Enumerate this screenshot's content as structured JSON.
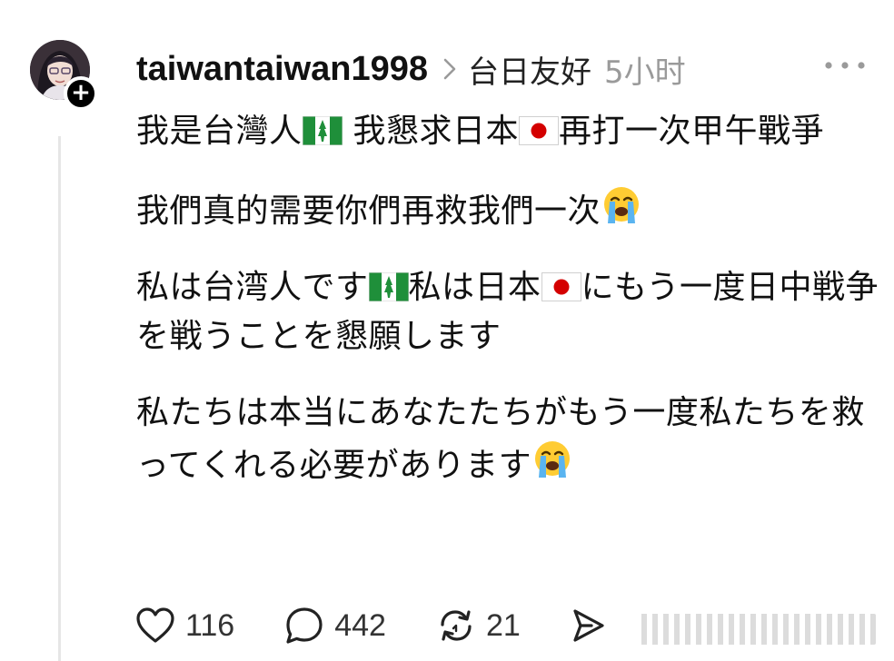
{
  "post": {
    "username": "taiwantaiwan1998",
    "community": "台日友好",
    "time": "5小时",
    "paragraphs": [
      {
        "segments": [
          {
            "text": "我是台灣人"
          },
          {
            "icon": "flag-norfolk-island-icon"
          },
          {
            "text": " 我懇求日本"
          },
          {
            "icon": "flag-japan-icon"
          },
          {
            "text": "再打一次甲午戰爭"
          }
        ]
      },
      {
        "segments": [
          {
            "text": "我們真的需要你們再救我們一次"
          },
          {
            "icon": "loudly-crying-face-icon"
          }
        ]
      },
      {
        "segments": [
          {
            "text": "私は台湾人です"
          },
          {
            "icon": "flag-norfolk-island-icon"
          },
          {
            "text": "私は日本"
          },
          {
            "icon": "flag-japan-icon"
          },
          {
            "text": "にもう一度日中戦争を戦うことを懇願します"
          }
        ]
      },
      {
        "segments": [
          {
            "text": "私たちは本当にあなたたちがもう一度私たちを救ってくれる必要があります"
          },
          {
            "icon": "loudly-crying-face-icon"
          }
        ]
      }
    ]
  },
  "actions": {
    "likes": "116",
    "comments": "442",
    "reposts": "21"
  },
  "icons": {
    "more": "more-dots-icon",
    "follow": "plus-icon",
    "like": "heart-icon",
    "comment": "comment-bubble-icon",
    "repost": "repost-icon",
    "share": "share-icon"
  },
  "colors": {
    "text": "#111111",
    "muted": "#9a9a9a",
    "flag_green": "#1f8f3a",
    "flag_red": "#d40000",
    "thread_line": "#e6e6e6"
  }
}
